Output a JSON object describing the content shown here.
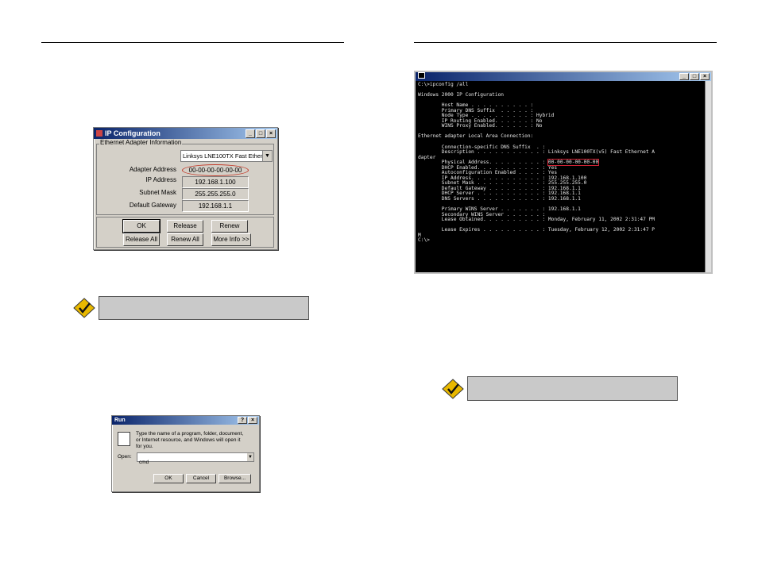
{
  "ip_config_dialog": {
    "title": "IP Configuration",
    "group_label": "Ethernet Adapter Information",
    "adapter_select": "Linksys LNE100TX Fast Ethernet",
    "fields": [
      {
        "label": "Adapter Address",
        "value": "00-00-00-00-00-00"
      },
      {
        "label": "IP Address",
        "value": "192.168.1.100"
      },
      {
        "label": "Subnet Mask",
        "value": "255.255.255.0"
      },
      {
        "label": "Default Gateway",
        "value": "192.168.1.1"
      }
    ],
    "buttons": [
      "OK",
      "Release",
      "Renew",
      "Release All",
      "Renew All",
      "More Info >>"
    ]
  },
  "run_dialog": {
    "title": "Run",
    "help_button": "?",
    "close_button": "×",
    "description": "Type the name of a program, folder, document, or Internet resource, and Windows will open it for you.",
    "open_label": "Open:",
    "open_value": "cmd",
    "buttons": [
      "OK",
      "Cancel",
      "Browse..."
    ]
  },
  "console": {
    "lines": [
      "C:\\>ipconfig /all",
      "",
      "Windows 2000 IP Configuration",
      "",
      "        Host Name . . . . . . . . . . :",
      "        Primary DNS Suffix  . . . . . :",
      "        Node Type . . . . . . . . . . : Hybrid",
      "        IP Routing Enabled. . . . . . : No",
      "        WINS Proxy Enabled. . . . . . : No",
      "",
      "Ethernet adapter Local Area Connection:",
      "",
      "        Connection-specific DNS Suffix  . :",
      "        Description . . . . . . . . . . . : Linksys LNE100TX(v5) Fast Ethernet A",
      "dapter",
      "        Physical Address. . . . . . . . . : 00-00-00-00-00-00",
      "        DHCP Enabled. . . . . . . . . . . : Yes",
      "        Autoconfiguration Enabled . . . . : Yes",
      "        IP Address. . . . . . . . . . . . : 192.168.1.100",
      "        Subnet Mask . . . . . . . . . . . : 255.255.255.0",
      "        Default Gateway . . . . . . . . . : 192.168.1.1",
      "        DHCP Server . . . . . . . . . . . : 192.168.1.1",
      "        DNS Servers . . . . . . . . . . . : 192.168.1.1",
      "",
      "        Primary WINS Server . . . . . . . : 192.168.1.1",
      "        Secondary WINS Server . . . . . . :",
      "        Lease Obtained. . . . . . . . . . : Monday, February 11, 2002 2:31:47 PM",
      "",
      "        Lease Expires . . . . . . . . . . : Tuesday, February 12, 2002 2:31:47 P",
      "M",
      "C:\\>"
    ]
  },
  "colors": {
    "note_fill": "#c9c9c9",
    "check_icon": "#e8b800",
    "highlight_oval": "#c23a2a"
  }
}
